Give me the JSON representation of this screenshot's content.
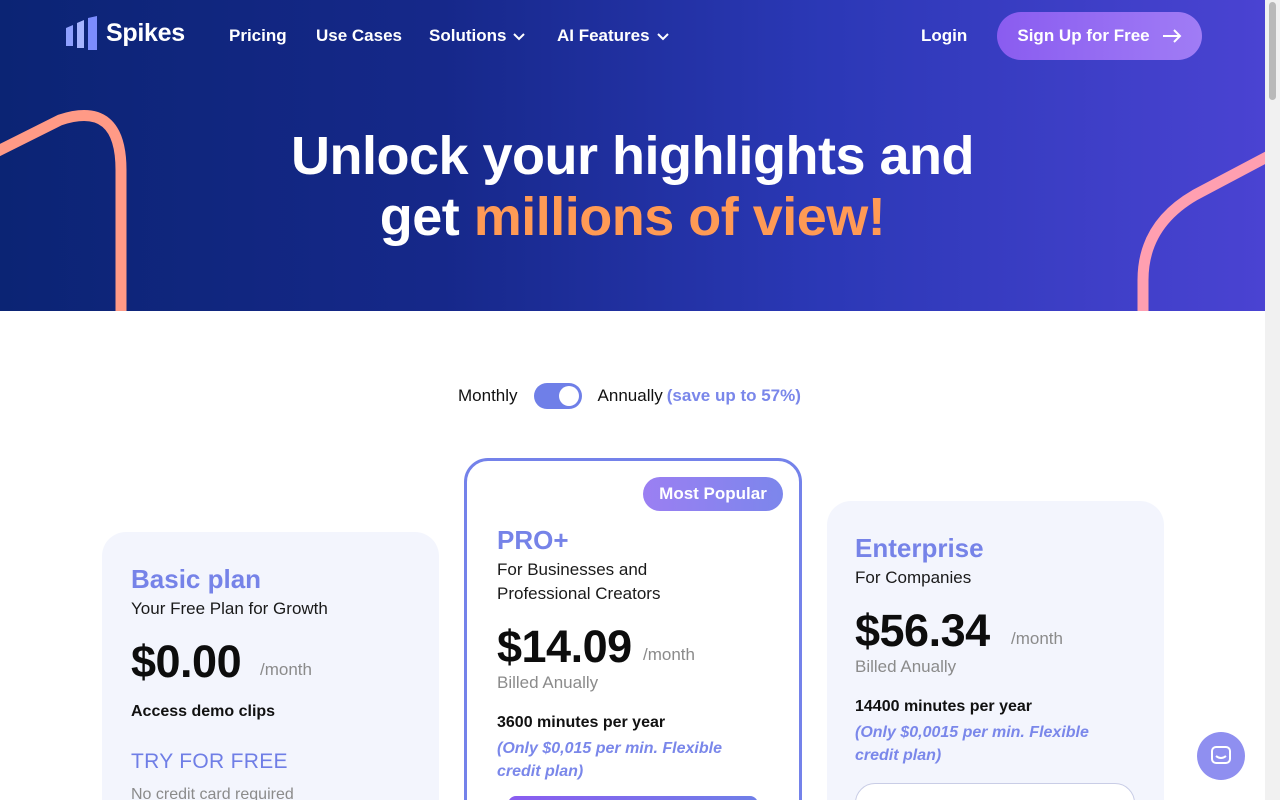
{
  "brand": {
    "name": "Spikes"
  },
  "nav": {
    "pricing": "Pricing",
    "use_cases": "Use Cases",
    "solutions": "Solutions",
    "ai_features": "AI Features",
    "login": "Login",
    "signup": "Sign Up for Free"
  },
  "hero": {
    "line1": "Unlock your highlights and",
    "line2_prefix": "get ",
    "line2_accent": "millions of view!"
  },
  "billing": {
    "monthly": "Monthly",
    "annually": "Annually",
    "save": "(save up to 57%)"
  },
  "plans": {
    "basic": {
      "name": "Basic plan",
      "subtitle": "Your Free Plan for Growth",
      "price": "$0.00",
      "per": "/month",
      "feature": "Access demo clips",
      "cta": "TRY FOR FREE",
      "note": "No credit card required"
    },
    "pro": {
      "badge": "Most Popular",
      "name": "PRO+",
      "subtitle_line1": "For Businesses and",
      "subtitle_line2": "Professional Creators",
      "price": "$14.09",
      "per": "/month",
      "billed": "Billed Anually",
      "feature": "3600 minutes per year",
      "note_line1": "(Only $0,015 per min. Flexible",
      "note_line2": "credit plan)"
    },
    "enterprise": {
      "name": "Enterprise",
      "subtitle": "For Companies",
      "price": "$56.34",
      "per": "/month",
      "billed": "Billed Anually",
      "feature": "14400 minutes per year",
      "note_line1": "(Only $0,0015 per min. Flexible",
      "note_line2": "credit plan)"
    }
  },
  "colors": {
    "hero_start": "#0b2474",
    "hero_end": "#4a43d2",
    "accent_orange": "#ff9a55",
    "accent_purple": "#7683e8",
    "signup_gradient": "#8a5cf0"
  },
  "icons": {
    "logo": "bars-logo-icon",
    "chevron": "chevron-down-icon",
    "arrow": "arrow-right-icon",
    "chat": "chat-icon"
  }
}
